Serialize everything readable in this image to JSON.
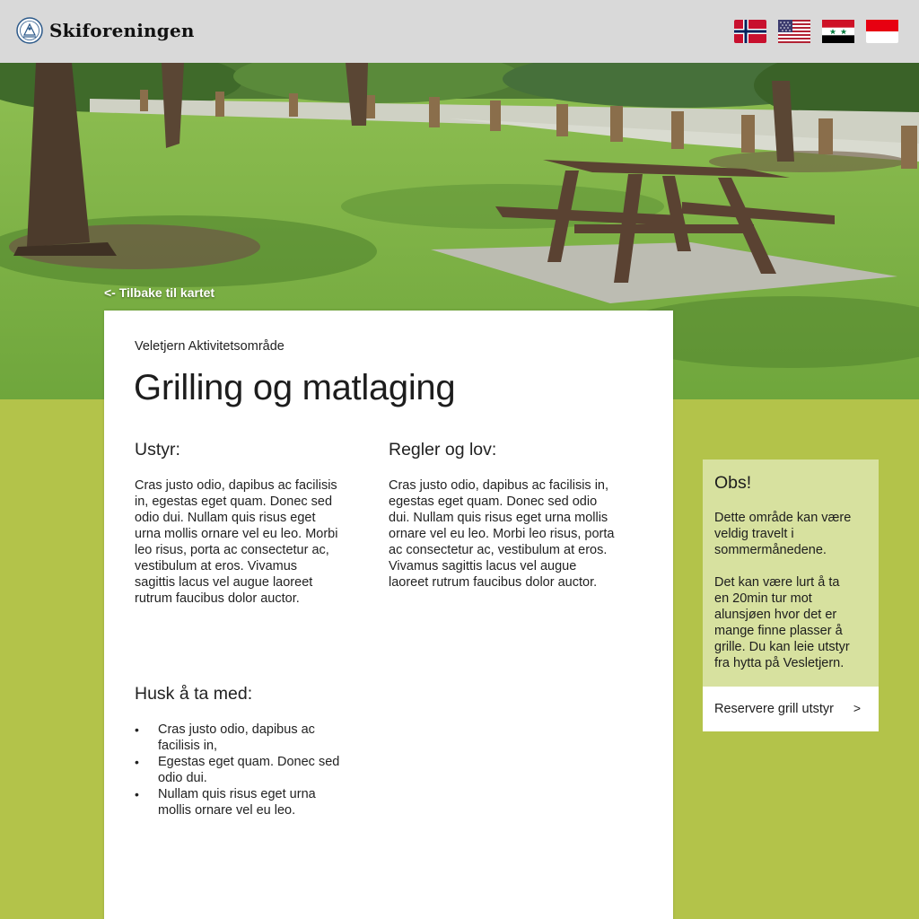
{
  "header": {
    "brand": "Skiforeningen",
    "flags": [
      {
        "name": "norwegian-flag",
        "lang": "no"
      },
      {
        "name": "us-flag",
        "lang": "en"
      },
      {
        "name": "syrian-flag",
        "lang": "ar"
      },
      {
        "name": "indonesian-flag",
        "lang": "id"
      }
    ]
  },
  "hero": {
    "back_link": "<- Tilbake til kartet"
  },
  "content": {
    "breadcrumb": "Veletjern Aktivitetsområde",
    "title": "Grilling og matlaging",
    "equipment": {
      "heading": "Ustyr:",
      "lines": [
        "Cras justo odio, dapibus ac facilisis",
        "in, egestas eget quam. Donec sed",
        "odio dui. Nullam quis risus eget",
        "urna mollis ornare vel eu leo. Morbi",
        "leo risus, porta ac consectetur ac,",
        "vestibulum at eros. Vivamus",
        "sagittis lacus vel augue laoreet",
        "rutrum faucibus dolor auctor."
      ]
    },
    "rules": {
      "heading": "Regler og lov:",
      "lines": [
        "Cras justo odio, dapibus ac facilisis in,",
        "egestas eget quam. Donec sed odio",
        "dui. Nullam quis risus eget urna mollis",
        "ornare vel eu leo. Morbi leo risus, porta",
        "ac consectetur ac, vestibulum at eros.",
        "Vivamus sagittis lacus vel augue",
        "laoreet rutrum faucibus dolor auctor."
      ]
    },
    "remember": {
      "heading": "Husk å ta med:",
      "items": [
        {
          "line1": "Cras justo odio, dapibus ac",
          "line2": "facilisis in,"
        },
        {
          "line1": "Egestas eget quam. Donec sed",
          "line2": "odio dui."
        },
        {
          "line1": "Nullam quis risus eget urna",
          "line2": "mollis ornare vel eu leo."
        }
      ]
    }
  },
  "sidebar": {
    "title": "Obs!",
    "paragraph1": [
      "Dette område kan være",
      "veldig travelt i",
      "sommermånedene."
    ],
    "paragraph2": [
      "Det kan være lurt å ta",
      "en 20min tur mot",
      "alunsjøen hvor det er",
      "mange finne plasser å",
      "grille. Du kan leie utstyr",
      "fra hytta på Vesletjern."
    ],
    "button_label": "Reservere grill utstyr",
    "button_chevron": ">"
  },
  "colors": {
    "header_bg": "#d9d9d9",
    "page_bg": "#b3c34a",
    "sidebar_bg": "#d7e19f",
    "card_bg": "#ffffff"
  }
}
